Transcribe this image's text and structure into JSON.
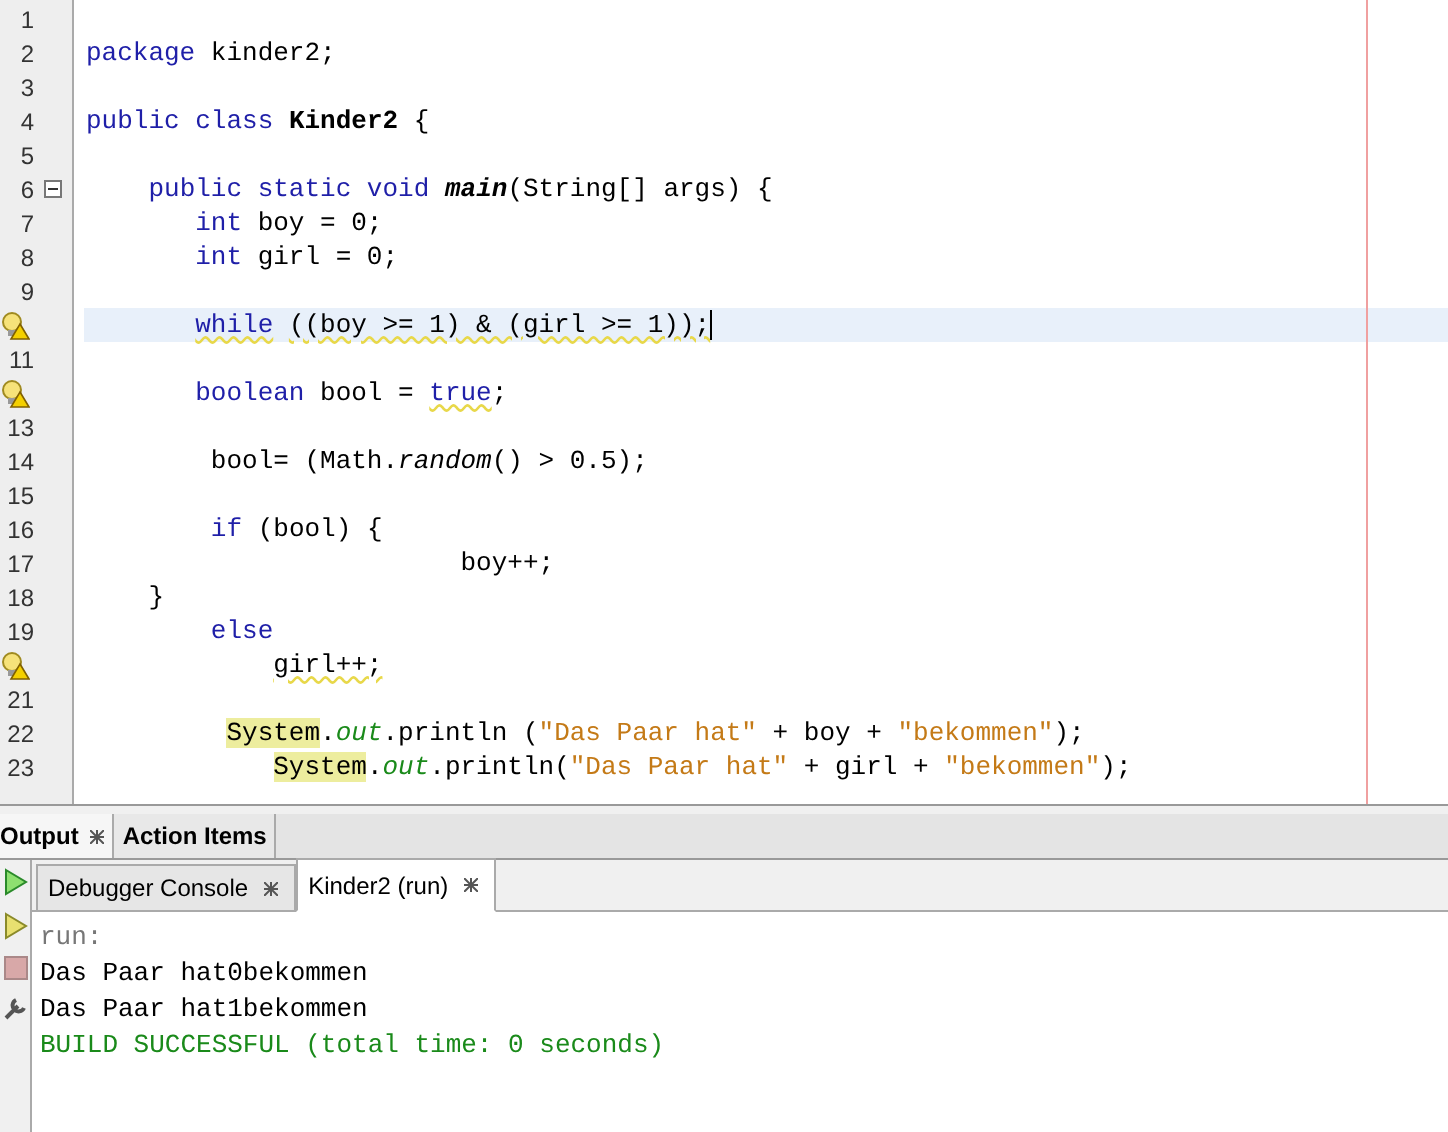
{
  "editor": {
    "lines": [
      {
        "number": "1",
        "warning": false,
        "fold": false,
        "current": false
      },
      {
        "number": "2",
        "warning": false,
        "fold": false,
        "current": false,
        "tokens": [
          {
            "text": "package",
            "kind": "keyword"
          },
          {
            "text": " kinder2;",
            "kind": "plain"
          }
        ]
      },
      {
        "number": "3",
        "warning": false,
        "fold": false,
        "current": false
      },
      {
        "number": "4",
        "warning": false,
        "fold": false,
        "current": false,
        "tokens": [
          {
            "text": "public class",
            "kind": "keyword"
          },
          {
            "text": " Kinder2",
            "kind": "bold"
          },
          {
            "text": " {",
            "kind": "plain"
          }
        ]
      },
      {
        "number": "5",
        "warning": false,
        "fold": false,
        "current": false
      },
      {
        "number": "6",
        "warning": false,
        "fold": true,
        "current": false,
        "tokens": [
          {
            "text": "    public static void",
            "kind": "keyword"
          },
          {
            "text": " main",
            "kind": "bolditalic"
          },
          {
            "text": "(String[] args) {",
            "kind": "plain"
          }
        ]
      },
      {
        "number": "7",
        "warning": false,
        "fold": false,
        "current": false,
        "tokens": [
          {
            "text": "       int",
            "kind": "keyword"
          },
          {
            "text": " boy = 0;",
            "kind": "plain"
          }
        ]
      },
      {
        "number": "8",
        "warning": false,
        "fold": false,
        "current": false,
        "tokens": [
          {
            "text": "       int",
            "kind": "keyword"
          },
          {
            "text": " girl = 0;",
            "kind": "plain"
          }
        ]
      },
      {
        "number": "9",
        "warning": false,
        "fold": false,
        "current": false
      },
      {
        "warning": true,
        "fold": false,
        "current": true,
        "tokens": [
          {
            "text": "       while",
            "kind": "keyword-warn"
          },
          {
            "text": " ((boy >= 1) & (girl >= 1));",
            "kind": "warn"
          }
        ]
      },
      {
        "number": "11",
        "warning": false,
        "fold": false,
        "current": false
      },
      {
        "warning": true,
        "fold": false,
        "current": false,
        "tokens": [
          {
            "text": "       boolean",
            "kind": "keyword"
          },
          {
            "text": " bool = ",
            "kind": "plain"
          },
          {
            "text": "true",
            "kind": "keyword-warn"
          },
          {
            "text": ";",
            "kind": "plain"
          }
        ]
      },
      {
        "number": "13",
        "warning": false,
        "fold": false,
        "current": false
      },
      {
        "number": "14",
        "warning": false,
        "fold": false,
        "current": false,
        "tokens": [
          {
            "text": "        bool= (Math.",
            "kind": "plain"
          },
          {
            "text": "random",
            "kind": "italic"
          },
          {
            "text": "() > 0.5);",
            "kind": "plain"
          }
        ]
      },
      {
        "number": "15",
        "warning": false,
        "fold": false,
        "current": false
      },
      {
        "number": "16",
        "warning": false,
        "fold": false,
        "current": false,
        "tokens": [
          {
            "text": "        if",
            "kind": "keyword"
          },
          {
            "text": " (bool) {",
            "kind": "plain"
          }
        ]
      },
      {
        "number": "17",
        "warning": false,
        "fold": false,
        "current": false,
        "tokens": [
          {
            "text": "                        boy++;",
            "kind": "plain"
          }
        ]
      },
      {
        "number": "18",
        "warning": false,
        "fold": false,
        "current": false,
        "tokens": [
          {
            "text": "    }",
            "kind": "plain"
          }
        ]
      },
      {
        "number": "19",
        "warning": false,
        "fold": false,
        "current": false,
        "tokens": [
          {
            "text": "        else",
            "kind": "keyword"
          }
        ]
      },
      {
        "warning": true,
        "fold": false,
        "current": false,
        "tokens": [
          {
            "text": "            girl++;",
            "kind": "warn"
          }
        ]
      },
      {
        "number": "21",
        "warning": false,
        "fold": false,
        "current": false
      },
      {
        "number": "22",
        "warning": false,
        "fold": false,
        "current": false,
        "tokens": [
          {
            "text": "         System",
            "kind": "marked"
          },
          {
            "text": ".",
            "kind": "plain"
          },
          {
            "text": "out",
            "kind": "field"
          },
          {
            "text": ".println (",
            "kind": "plain"
          },
          {
            "text": "\"Das Paar hat\"",
            "kind": "string"
          },
          {
            "text": " + boy + ",
            "kind": "plain"
          },
          {
            "text": "\"bekommen\"",
            "kind": "string"
          },
          {
            "text": ");",
            "kind": "plain"
          }
        ]
      },
      {
        "number": "23",
        "warning": false,
        "fold": false,
        "current": false,
        "tokens": [
          {
            "text": "            System",
            "kind": "marked"
          },
          {
            "text": ".",
            "kind": "plain"
          },
          {
            "text": "out",
            "kind": "field"
          },
          {
            "text": ".println(",
            "kind": "plain"
          },
          {
            "text": "\"Das Paar hat\"",
            "kind": "string"
          },
          {
            "text": " + girl + ",
            "kind": "plain"
          },
          {
            "text": "\"bekommen\"",
            "kind": "string"
          },
          {
            "text": ");",
            "kind": "plain"
          }
        ]
      }
    ]
  },
  "panel_tabs": [
    {
      "label": "Output",
      "selected": true,
      "closable": true
    },
    {
      "label": "Action Items",
      "selected": false,
      "closable": false
    }
  ],
  "output_tabs": [
    {
      "label": "Debugger Console",
      "selected": false
    },
    {
      "label": "Kinder2 (run)",
      "selected": true
    }
  ],
  "output_lines": [
    {
      "text": "run:",
      "kind": "info"
    },
    {
      "text": "Das Paar hat0bekommen",
      "kind": "plain"
    },
    {
      "text": "Das Paar hat1bekommen",
      "kind": "plain"
    },
    {
      "text": "BUILD SUCCESSFUL (total time: 0 seconds)",
      "kind": "success"
    }
  ]
}
